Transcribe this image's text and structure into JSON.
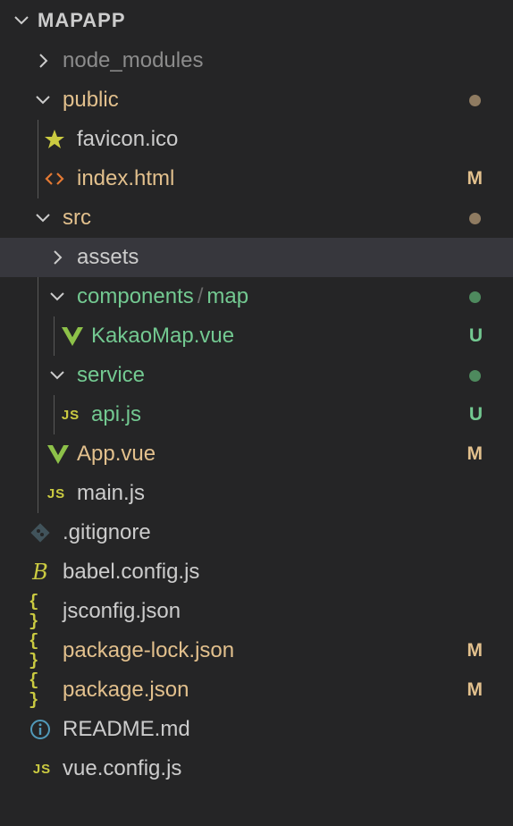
{
  "explorer": {
    "section_title": "MAPAPP",
    "items": [
      {
        "label": "node_modules",
        "badge": ""
      },
      {
        "label": "public",
        "badge": ""
      },
      {
        "label": "favicon.ico",
        "badge": ""
      },
      {
        "label": "index.html",
        "badge": "M"
      },
      {
        "label": "src",
        "badge": ""
      },
      {
        "label": "assets",
        "badge": ""
      },
      {
        "label_parts": [
          "components",
          "/",
          "map"
        ],
        "badge": ""
      },
      {
        "label": "KakaoMap.vue",
        "badge": "U"
      },
      {
        "label": "service",
        "badge": ""
      },
      {
        "label": "api.js",
        "badge": "U"
      },
      {
        "label": "App.vue",
        "badge": "M"
      },
      {
        "label": "main.js",
        "badge": ""
      },
      {
        "label": ".gitignore",
        "badge": ""
      },
      {
        "label": "babel.config.js",
        "badge": ""
      },
      {
        "label": "jsconfig.json",
        "badge": ""
      },
      {
        "label": "package-lock.json",
        "badge": "M"
      },
      {
        "label": "package.json",
        "badge": "M"
      },
      {
        "label": "README.md",
        "badge": ""
      },
      {
        "label": "vue.config.js",
        "badge": ""
      }
    ],
    "icons": {
      "js_text": "JS",
      "json_text": "{ }",
      "babel_text": "B"
    },
    "colors": {
      "background": "#252526",
      "selected_row": "#37373d",
      "modified": "#e2c08d",
      "untracked": "#73c991",
      "ignored": "#8c8c8c",
      "default_text": "#cccccc",
      "js_icon": "#cbcb41",
      "html_icon": "#e37933",
      "vue_icon": "#8dc149",
      "info_icon": "#519aba",
      "git_icon": "#41535b"
    }
  }
}
